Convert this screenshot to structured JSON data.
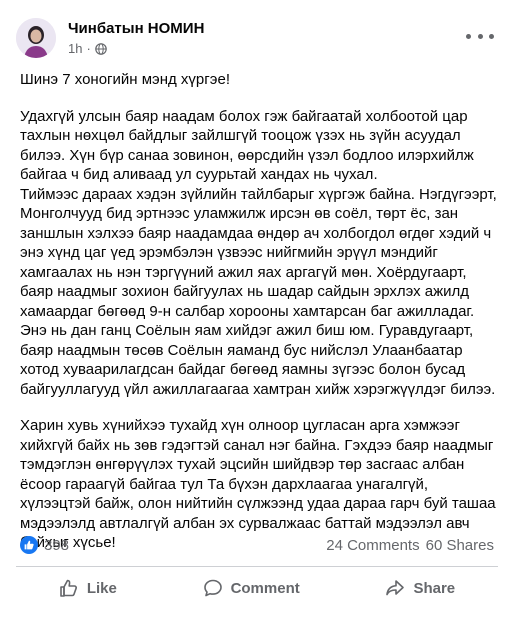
{
  "post": {
    "author": "Чинбатын НОМИН",
    "time": "1h",
    "separator": "·",
    "paragraphs": [
      "Шинэ 7 хоногийн мэнд хүргэе!",
      "Удахгүй улсын баяр наадам болох гэж байгаатай холбоотой цар тахлын нөхцөл байдлыг зайлшгүй тооцож үзэх нь зүйн асуудал билээ. Хүн бүр санаа зовинон, өөрсдийн үзэл бодлоо илэрхийлж байгаа ч бид аливаад ул суурьтай хандах нь чухал.\nТиймээс дараах хэдэн зүйлийн тайлбарыг хүргэж байна. Нэгдүгээрт, Монголчууд бид эртнээс уламжилж ирсэн өв соёл, төрт ёс, зан заншлын хэлхээ баяр наадамдаа өндөр ач холбогдол өгдөг хэдий ч энэ хүнд цаг үед эрэмбэлэн үзвээс нийгмийн эрүүл мэндийг хамгаалах нь нэн тэргүүний ажил яах аргагүй мөн. Хоёрдугаарт, баяр наадмыг зохион байгуулах нь шадар сайдын эрхлэх ажилд хамаардаг бөгөөд 9-н салбар хорооны хамтарсан баг ажилладаг. Энэ нь дан ганц Соёлын яам хийдэг ажил биш юм. Гуравдугаарт, баяр наадмын төсөв Соёлын яаманд бус нийслэл Улаанбаатар хотод хуваарилагдсан байдаг бөгөөд яамны зүгээс болон бусад байгууллагууд үйл ажиллагаагаа хамтран хийж хэрэгжүүлдэг билээ.",
      "Харин хувь хүнийхээ тухайд хүн олноор цугласан арга хэмжээг хийхгүй байх нь зөв гэдэгтэй санал нэг байна. Гэхдээ баяр наадмыг тэмдэглэн өнгөрүүлэх тухай эцсийн шийдвэр төр засгаас албан ёсоор гараагүй байгаа тул Та бүхэн дархлаагаа унагалгүй, хүлээцтэй байж, олон нийтийн сүлжээнд удаа дараа гарч буй ташаа мэдээлэлд автлалгүй албан эх сурвалжаас баттай мэдээлэл авч байхыг хүсье!"
    ]
  },
  "stats": {
    "reactions": "398",
    "comments": "24 Comments",
    "shares": "60 Shares"
  },
  "actions": {
    "like": "Like",
    "comment": "Comment",
    "share": "Share"
  },
  "colors": {
    "accent": "#1877f2",
    "muted": "#65676b"
  }
}
